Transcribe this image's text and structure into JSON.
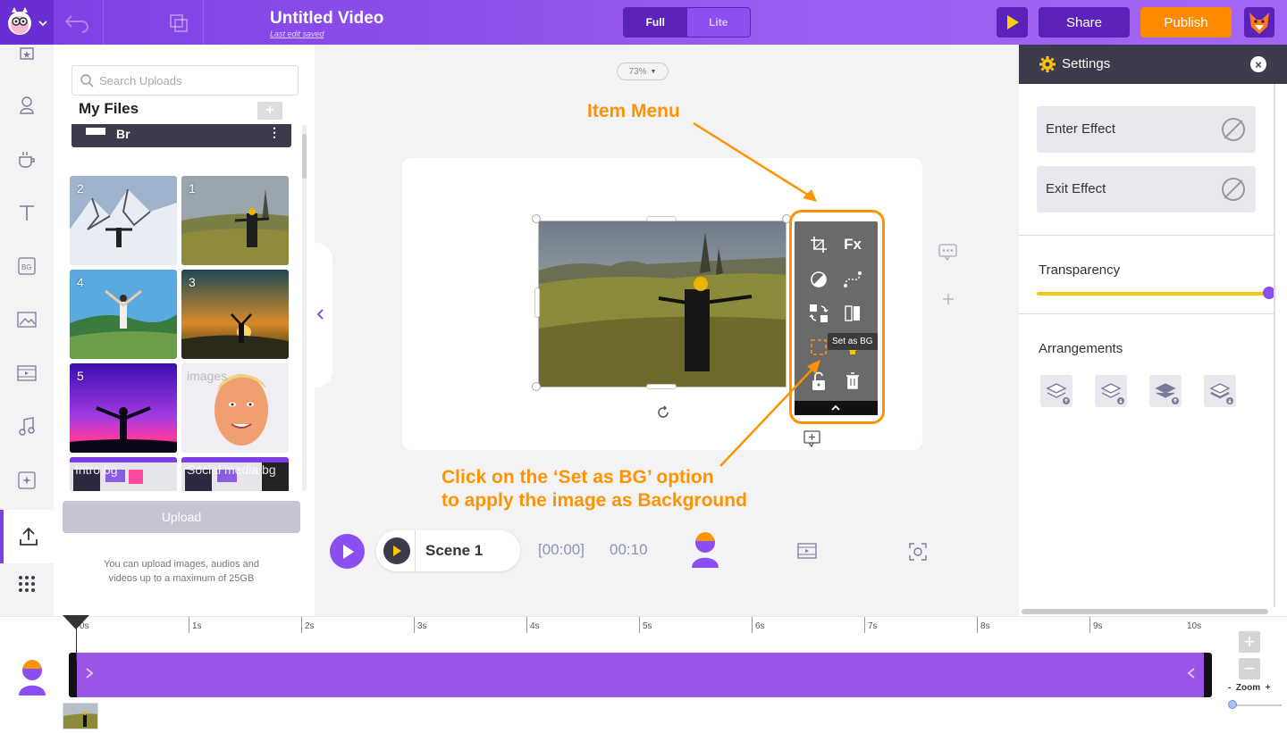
{
  "app": {
    "title": "Untitled Video",
    "last_saved": "Last edit saved",
    "modes": [
      "Full",
      "Lite"
    ],
    "share_label": "Share",
    "publish_label": "Publish"
  },
  "rail": {
    "icons": [
      "characters-icon",
      "person-icon",
      "props-icon",
      "text-icon",
      "bg-icon",
      "image-icon",
      "video-icon",
      "music-icon",
      "effects-icon",
      "upload-icon",
      "more-apps-icon"
    ],
    "bg_label": "BG"
  },
  "uploads": {
    "search_placeholder": "Search Uploads",
    "my_files": "My Files",
    "new_folder": "+",
    "folder_name": "Br",
    "thumbnails": [
      {
        "label": "2"
      },
      {
        "label": "1"
      },
      {
        "label": "4"
      },
      {
        "label": "3"
      },
      {
        "label": "5"
      },
      {
        "label": "images"
      },
      {
        "label": "Intro bg"
      },
      {
        "label": "Social media bg"
      }
    ],
    "upload_label": "Upload",
    "note": "You can upload images, audios and videos up to a maximum of 25GB"
  },
  "canvas": {
    "zoom": "73%",
    "tooltip": "Set as BG",
    "menu_fx": "Fx",
    "annotation_top": "Item Menu",
    "annotation_bottom_1": "Click on the ‘Set as BG’ option",
    "annotation_bottom_2": "to apply the image as Background"
  },
  "scene": {
    "name": "Scene 1",
    "time_start": "[00:00]",
    "time_end": "00:10"
  },
  "settings": {
    "title": "Settings",
    "enter_effect": "Enter Effect",
    "exit_effect": "Exit Effect",
    "transparency": "Transparency",
    "transparency_value": 1.0,
    "arrangements": "Arrangements"
  },
  "timeline": {
    "ticks": [
      "0s",
      "1s",
      "2s",
      "3s",
      "4s",
      "5s",
      "6s",
      "7s",
      "8s",
      "9s",
      "10s"
    ],
    "zoom_label": "Zoom",
    "zoom_minus": "-",
    "zoom_plus": "+"
  },
  "colors": {
    "brand_purple": "#7b3fe4",
    "publish_orange": "#ff8a00",
    "annotation_orange": "#ff9300",
    "transparency_yellow": "#f5c518"
  }
}
